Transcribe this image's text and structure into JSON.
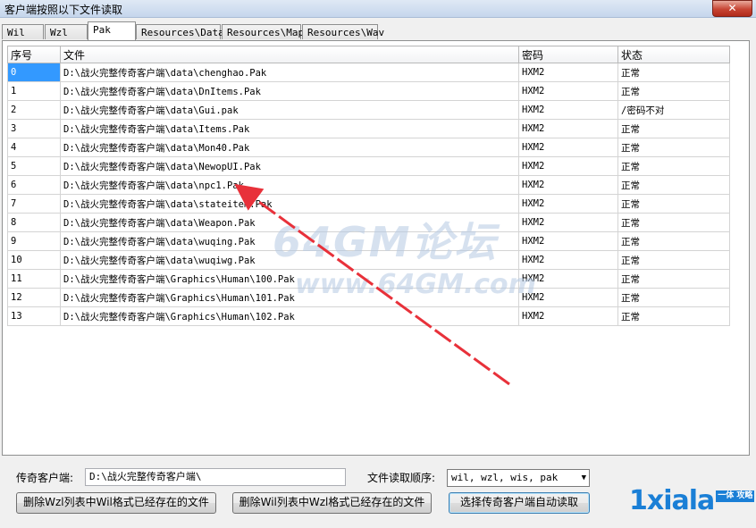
{
  "window": {
    "title": "客户端按照以下文件读取",
    "close_label": "✕"
  },
  "tabs": [
    "Wil",
    "Wzl",
    "Pak",
    "Resources\\Data",
    "Resources\\Map",
    "Resources\\Wav"
  ],
  "active_tab": "Pak",
  "table": {
    "columns": [
      "序号",
      "文件",
      "密码",
      "状态"
    ],
    "rows": [
      [
        "0",
        "D:\\战火完整传奇客户端\\data\\chenghao.Pak",
        "HXM2",
        "正常"
      ],
      [
        "1",
        "D:\\战火完整传奇客户端\\data\\DnItems.Pak",
        "HXM2",
        "正常"
      ],
      [
        "2",
        "D:\\战火完整传奇客户端\\data\\Gui.pak",
        "HXM2",
        "/密码不对"
      ],
      [
        "3",
        "D:\\战火完整传奇客户端\\data\\Items.Pak",
        "HXM2",
        "正常"
      ],
      [
        "4",
        "D:\\战火完整传奇客户端\\data\\Mon40.Pak",
        "HXM2",
        "正常"
      ],
      [
        "5",
        "D:\\战火完整传奇客户端\\data\\NewopUI.Pak",
        "HXM2",
        "正常"
      ],
      [
        "6",
        "D:\\战火完整传奇客户端\\data\\npc1.Pak",
        "HXM2",
        "正常"
      ],
      [
        "7",
        "D:\\战火完整传奇客户端\\data\\stateitem.Pak",
        "HXM2",
        "正常"
      ],
      [
        "8",
        "D:\\战火完整传奇客户端\\data\\Weapon.Pak",
        "HXM2",
        "正常"
      ],
      [
        "9",
        "D:\\战火完整传奇客户端\\data\\wuqing.Pak",
        "HXM2",
        "正常"
      ],
      [
        "10",
        "D:\\战火完整传奇客户端\\data\\wuqiwg.Pak",
        "HXM2",
        "正常"
      ],
      [
        "11",
        "D:\\战火完整传奇客户端\\Graphics\\Human\\100.Pak",
        "HXM2",
        "正常"
      ],
      [
        "12",
        "D:\\战火完整传奇客户端\\Graphics\\Human\\101.Pak",
        "HXM2",
        "正常"
      ],
      [
        "13",
        "D:\\战火完整传奇客户端\\Graphics\\Human\\102.Pak",
        "HXM2",
        "正常"
      ]
    ]
  },
  "watermark": {
    "line1": "64GM论坛",
    "line2": "www.64GM.com"
  },
  "client": {
    "label": "传奇客户端:",
    "path": "D:\\战火完整传奇客户端\\"
  },
  "order": {
    "label": "文件读取顺序:",
    "value": "wil, wzl, wis, pak"
  },
  "buttons": {
    "delete_wzl": "删除Wzl列表中Wil格式已经存在的文件",
    "delete_wil": "删除Wil列表中Wzl格式已经存在的文件",
    "auto_read": "选择传奇客户端自动读取"
  },
  "logo": {
    "text": "1xiala",
    "tag": "一体\n攻略"
  },
  "colors": {
    "selection": "#3399ff",
    "arrow": "#e8313a",
    "logo": "#1a7fd6"
  }
}
